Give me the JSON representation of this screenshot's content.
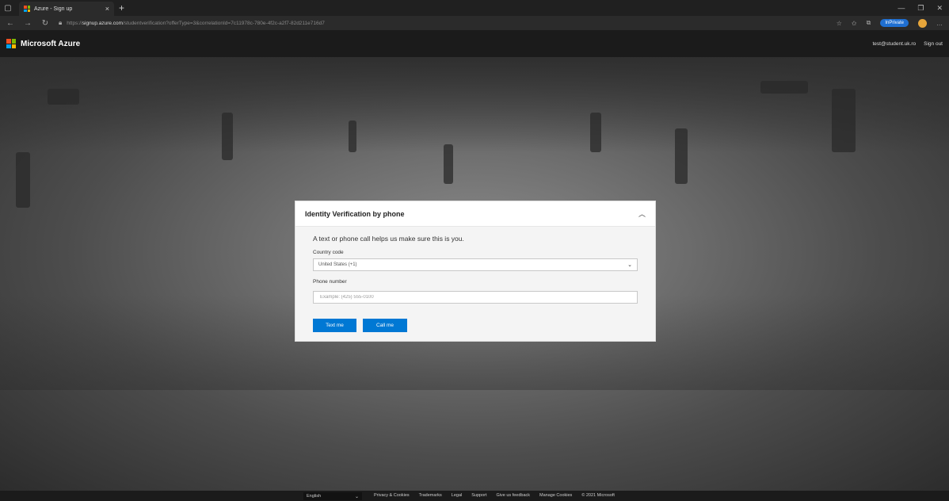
{
  "browser": {
    "tab_title": "Azure - Sign up",
    "tab_close": "×",
    "new_tab": "+",
    "url_prefix": "https://",
    "url_host": "signup.azure.com",
    "url_path": "/studentverification?offerType=3&correlationId=7c11978c-780e-4f2c-a2f7-82d211e716d7",
    "inprivate_label": "InPrivate",
    "icons": [
      "back-icon",
      "forward-icon",
      "refresh-icon",
      "lock-icon",
      "favorites-icon",
      "collections-icon",
      "more-icon"
    ]
  },
  "header": {
    "brand": "Microsoft Azure",
    "account": "test@student.uk.ro",
    "sign_out": "Sign out",
    "logo_colors": [
      "#f25022",
      "#7fba00",
      "#00a4ef",
      "#ffb900"
    ]
  },
  "dialog": {
    "title": "Identity Verification by phone",
    "lead": "A text or phone call helps us make sure this is you.",
    "country_label": "Country code",
    "country_value": "United States (+1)",
    "phone_label": "Phone number",
    "phone_placeholder": "Example: (425) 555-0100",
    "text_button": "Text me",
    "call_button": "Call me",
    "accent": "#0078d4"
  },
  "footer": {
    "language": "English",
    "links": [
      "Privacy & Cookies",
      "Trademarks",
      "Legal",
      "Support",
      "Give us feedback",
      "Manage Cookies",
      "© 2021 Microsoft"
    ]
  }
}
